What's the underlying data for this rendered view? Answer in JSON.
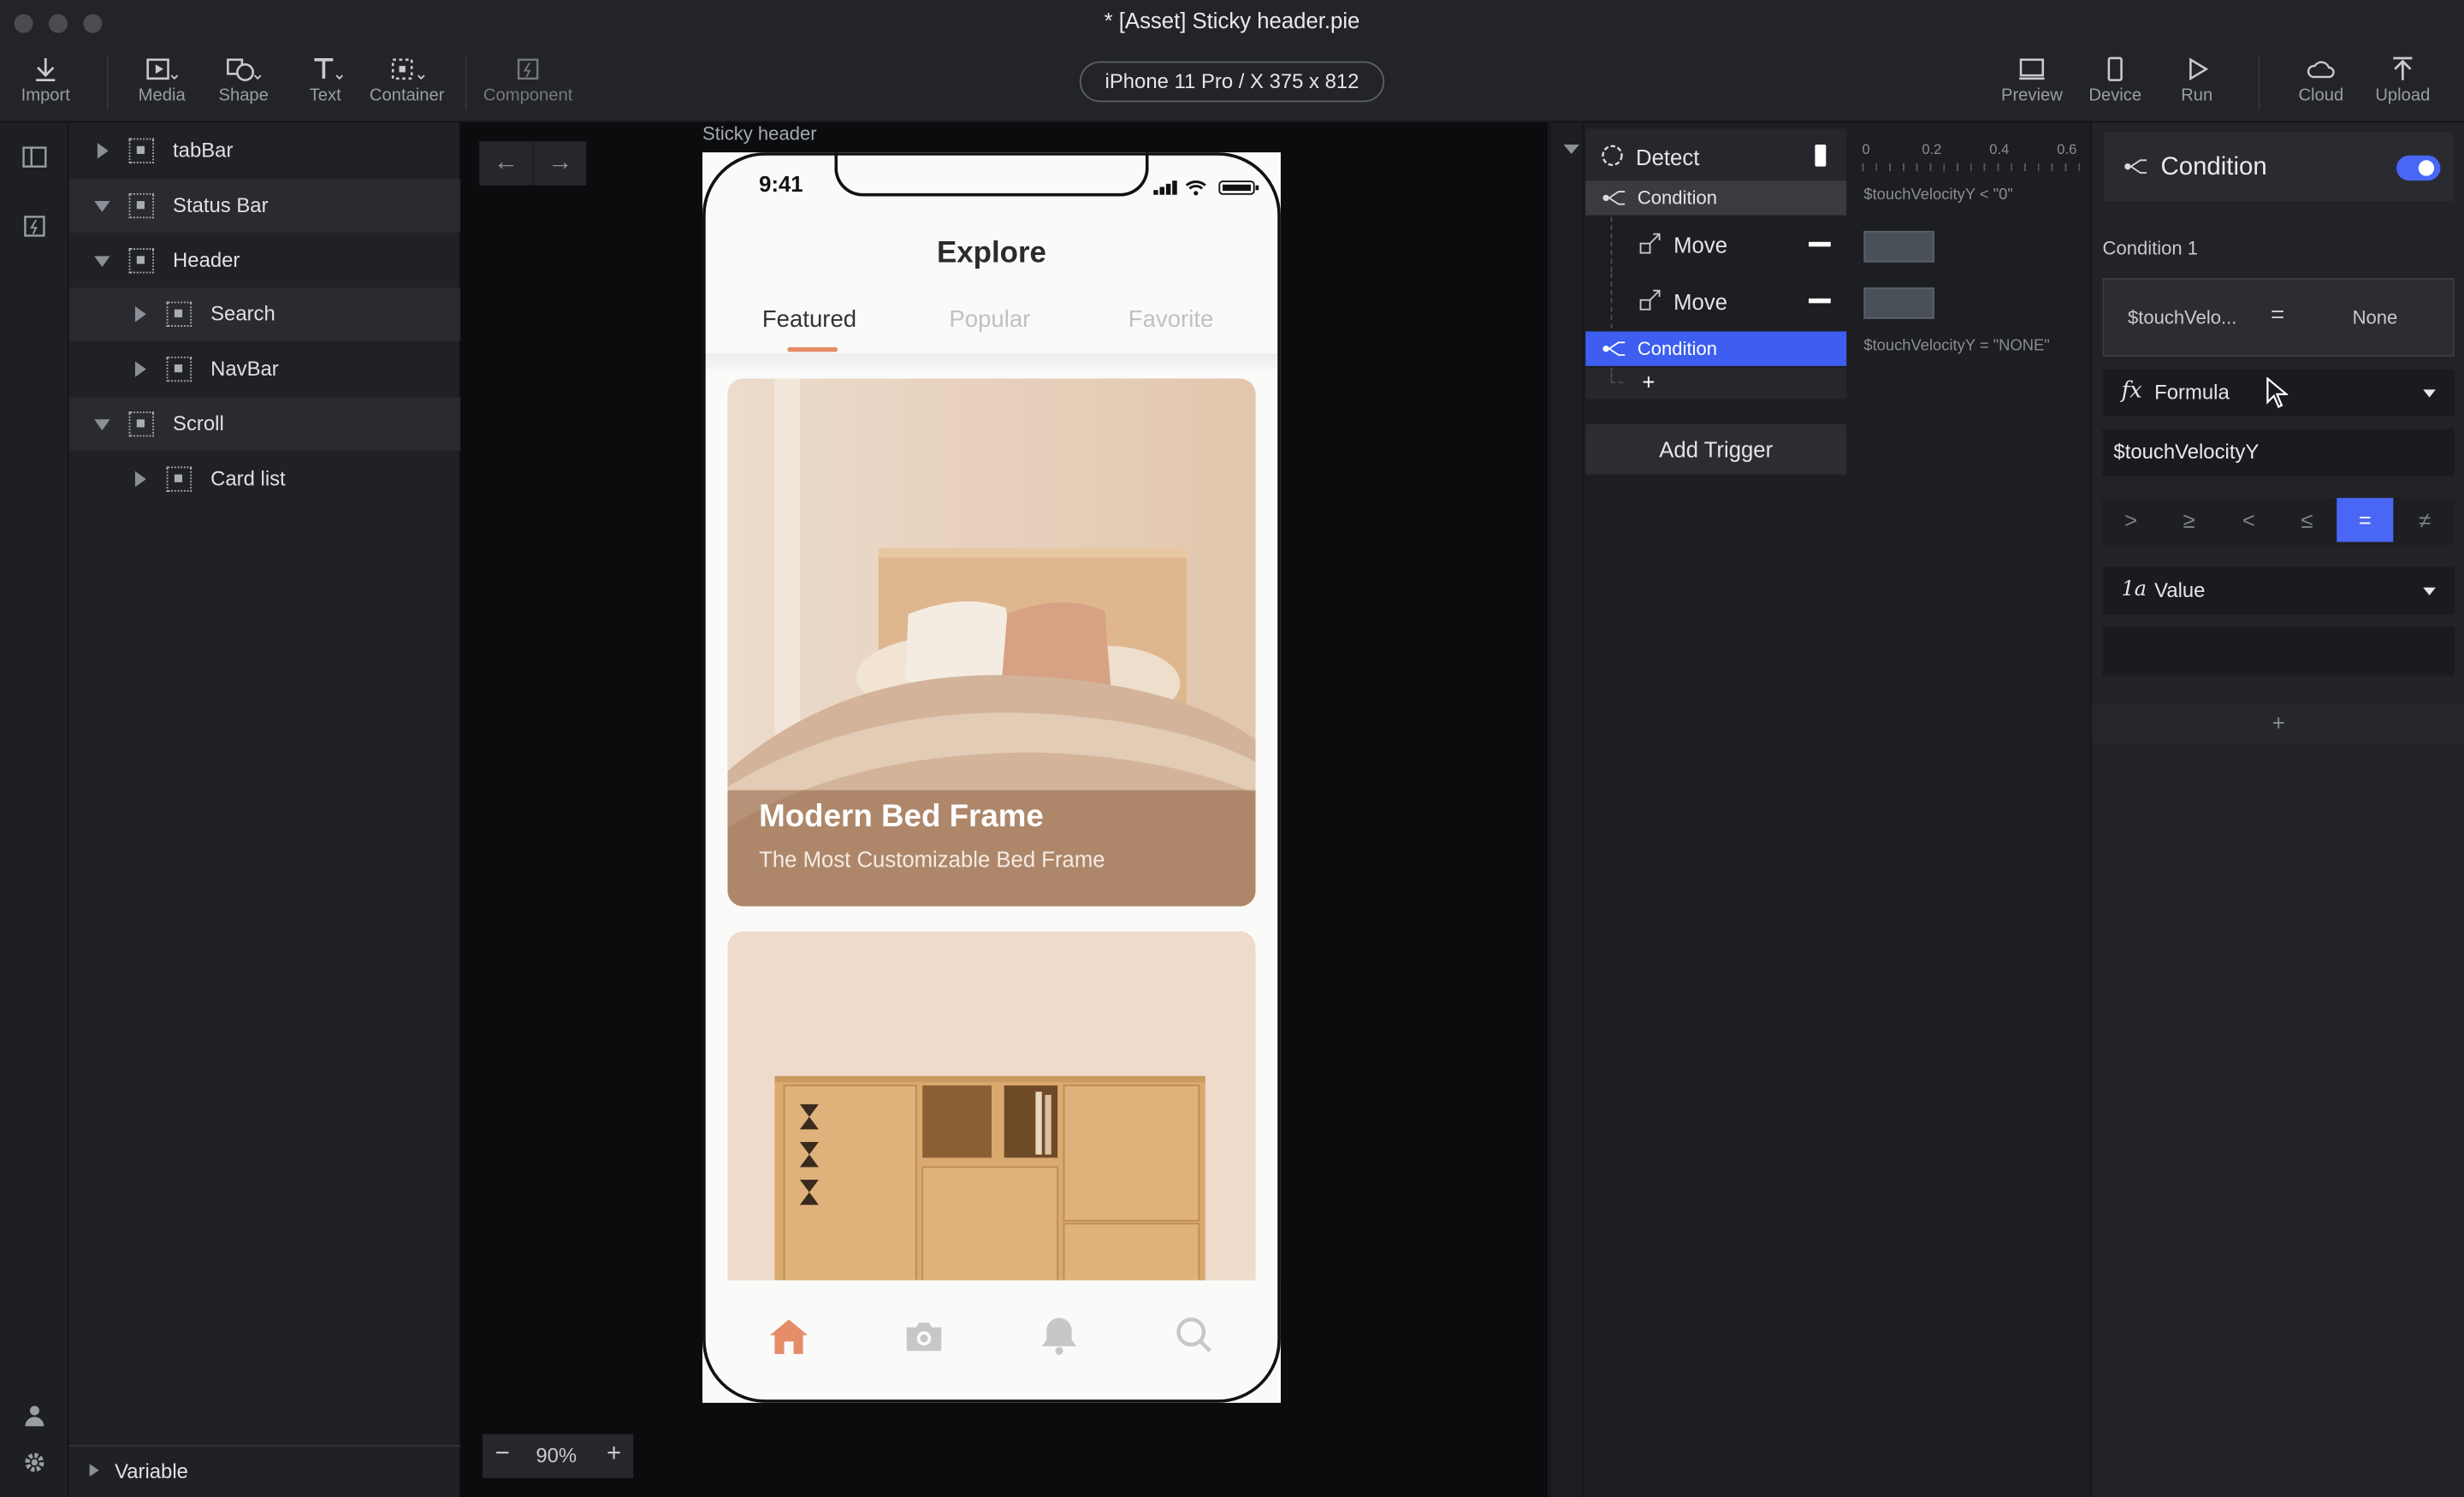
{
  "window": {
    "title": "* [Asset] Sticky header.pie"
  },
  "toolbar": {
    "import": "Import",
    "media": "Media",
    "shape": "Shape",
    "text": "Text",
    "container": "Container",
    "component": "Component",
    "device": "iPhone 11 Pro / X  375 x 812",
    "preview": "Preview",
    "device_btn": "Device",
    "run": "Run",
    "cloud": "Cloud",
    "upload": "Upload"
  },
  "layers": {
    "items": [
      "tabBar",
      "Status Bar",
      "Header",
      "Search",
      "NavBar",
      "Scroll",
      "Card list"
    ],
    "variable": "Variable"
  },
  "canvas": {
    "scene_label": "Sticky header",
    "zoom": "90%"
  },
  "phone": {
    "time": "9:41",
    "title": "Explore",
    "tabs": [
      "Featured",
      "Popular",
      "Favorite"
    ],
    "card1_title": "Modern Bed Frame",
    "card1_sub": "The Most Customizable Bed Frame"
  },
  "timeline": {
    "detect": "Detect",
    "condition1": "Condition",
    "move1": "Move",
    "move2": "Move",
    "condition2": "Condition",
    "add": "+",
    "add_trigger": "Add Trigger",
    "ruler": [
      "0",
      "0.2",
      "0.4",
      "0.6"
    ],
    "cond1_expr": "$touchVelocityY < \"0\"",
    "cond2_expr": "$touchVelocityY = \"NONE\""
  },
  "inspector": {
    "title": "Condition",
    "condition_label": "Condition 1",
    "summary_left": "$touchVelo...",
    "summary_op": "=",
    "summary_right": "None",
    "formula_icon": "fx",
    "formula": "Formula",
    "formula_value": "$touchVelocityY",
    "operators": [
      ">",
      "≥",
      "<",
      "≤",
      "=",
      "≠"
    ],
    "value_icon": "1a",
    "value": "Value",
    "add": "+"
  },
  "colors": {
    "accent": "#4a66f5",
    "brand_orange": "#e58c69",
    "selected_row": "#3d5ef0"
  }
}
